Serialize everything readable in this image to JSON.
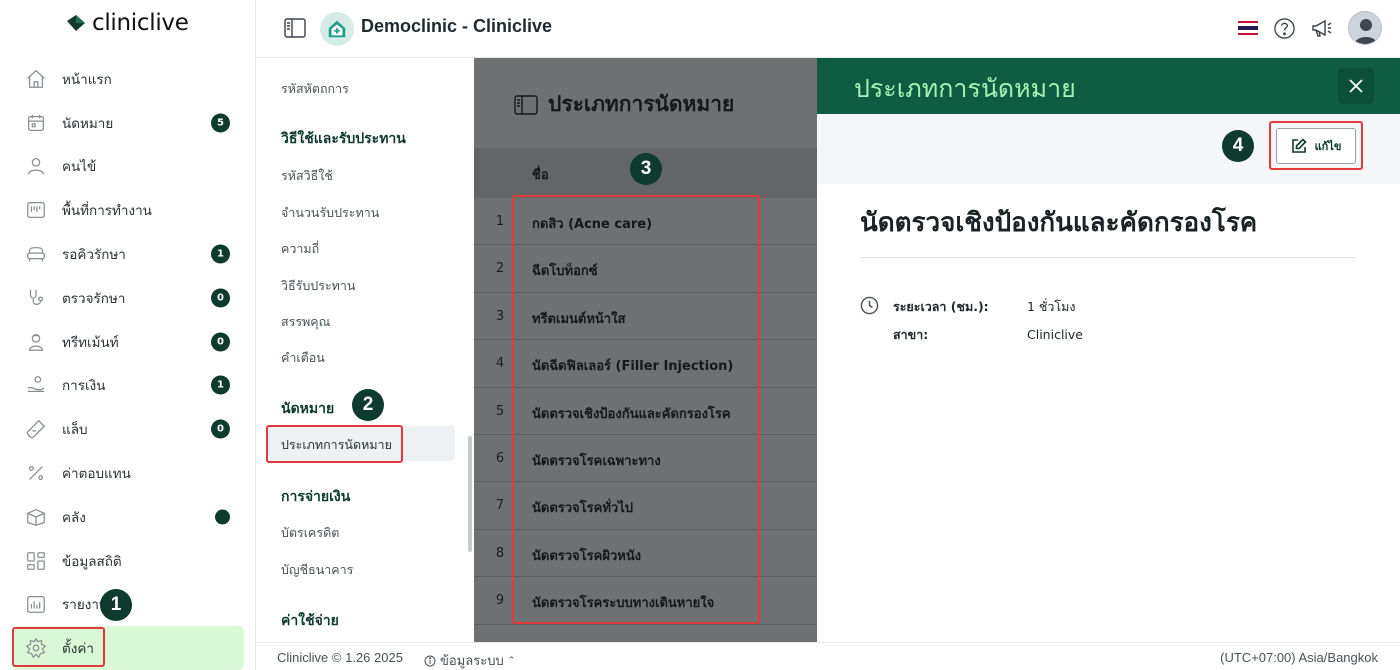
{
  "app": {
    "brand": "cliniclive",
    "title": "Democlinic - Cliniclive"
  },
  "sidebar": {
    "items": [
      {
        "label": "หน้าแรก",
        "icon": "home-icon"
      },
      {
        "label": "นัดหมาย",
        "icon": "calendar-icon",
        "badge": "5"
      },
      {
        "label": "คนไข้",
        "icon": "user-icon"
      },
      {
        "label": "พื้นที่การทำงาน",
        "icon": "workspace-icon"
      },
      {
        "label": "รอคิวรักษา",
        "icon": "sofa-icon",
        "badge": "1"
      },
      {
        "label": "ตรวจรักษา",
        "icon": "stethoscope-icon",
        "badge": "0"
      },
      {
        "label": "ทรีทเม้นท์",
        "icon": "doctor-icon",
        "badge": "0"
      },
      {
        "label": "การเงิน",
        "icon": "hand-money-icon",
        "badge": "1"
      },
      {
        "label": "แล็บ",
        "icon": "test-tube-icon",
        "badge": "0"
      },
      {
        "label": "ค่าตอบแทน",
        "icon": "percent-icon"
      },
      {
        "label": "คลัง",
        "icon": "box-icon"
      },
      {
        "label": "ข้อมูลสถิติ",
        "icon": "stats-icon"
      },
      {
        "label": "รายงาน",
        "icon": "report-icon"
      },
      {
        "label": "ตั้งค่า",
        "icon": "gear-icon"
      }
    ]
  },
  "settings": {
    "top_item": "รหัสหัตถการ",
    "group1": {
      "title": "วิธีใช้และรับประทาน",
      "items": [
        "รหัสวิธีใช้",
        "จำนวนรับประทาน",
        "ความถี่",
        "วิธีรับประทาน",
        "สรรพคุณ",
        "คำเตือน"
      ]
    },
    "group2": {
      "title": "นัดหมาย",
      "items": [
        "ประเภทการนัดหมาย"
      ]
    },
    "group3": {
      "title": "การจ่ายเงิน",
      "items": [
        "บัตรเครดิต",
        "บัญชีธนาคาร"
      ]
    },
    "group4": {
      "title": "ค่าใช้จ่าย"
    }
  },
  "list": {
    "title": "ประเภทการนัดหมาย",
    "column": "ชื่อ",
    "rows": [
      {
        "num": "1",
        "name": "กดสิว (Acne care)"
      },
      {
        "num": "2",
        "name": "ฉีดโบท็อกซ์"
      },
      {
        "num": "3",
        "name": "ทรีตเมนต์หน้าใส"
      },
      {
        "num": "4",
        "name": "นัดฉีดฟิลเลอร์ (Filler Injection)"
      },
      {
        "num": "5",
        "name": "นัดตรวจเชิงป้องกันและคัดกรองโรค"
      },
      {
        "num": "6",
        "name": "นัดตรวจโรคเฉพาะทาง"
      },
      {
        "num": "7",
        "name": "นัดตรวจโรคทั่วไป"
      },
      {
        "num": "8",
        "name": "นัดตรวจโรคผิวหนัง"
      },
      {
        "num": "9",
        "name": "นัดตรวจโรคระบบทางเดินหายใจ"
      }
    ]
  },
  "drawer": {
    "title": "ประเภทการนัดหมาย",
    "edit_label": "แก้ไข",
    "name": "นัดตรวจเชิงป้องกันและคัดกรองโรค",
    "duration_label": "ระยะเวลา (ชม.):",
    "duration_value": "1 ชั่วโมง",
    "branch_label": "สาขา:",
    "branch_value": "Cliniclive"
  },
  "footer": {
    "version": "Cliniclive © 1.26 2025",
    "system_info": "ข้อมูลระบบ",
    "timezone": "(UTC+07:00) Asia/Bangkok"
  },
  "steps": [
    "1",
    "2",
    "3",
    "4"
  ],
  "colors": {
    "brand_dark": "#0e3b2e",
    "drawer_header": "#0e5c42",
    "active_nav": "#d9f8d6",
    "highlight": "#e0393e"
  }
}
